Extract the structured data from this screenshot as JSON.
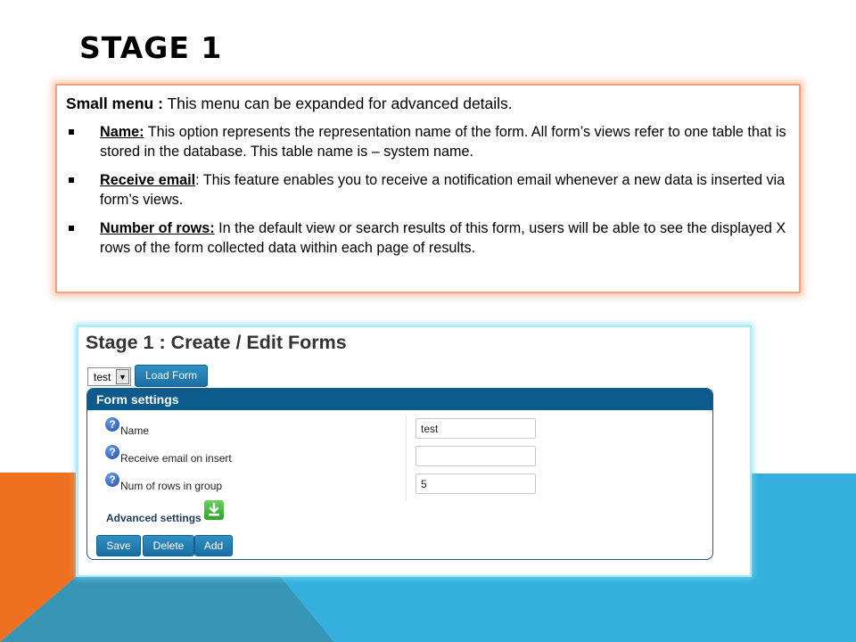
{
  "slide": {
    "title": "STAGE 1"
  },
  "info": {
    "intro_term": "Small menu :",
    "intro_text": " This menu can be expanded for advanced details.",
    "bullets": [
      {
        "term": "Name:",
        "text": " This option represents the representation name of the form. All form’s views refer to one table that is stored in the database. This table name is – system name."
      },
      {
        "term": "Receive email",
        "text": ": This feature enables you to receive a notification email whenever a new data is inserted via form’s views."
      },
      {
        "term": "Number of rows:",
        "text": " In the default view or search results of this form, users will be able to see the displayed X rows of the form collected data within each page of results."
      }
    ]
  },
  "form": {
    "heading": "Stage 1 : Create / Edit Forms",
    "select_value": "test",
    "load_button": "Load Form",
    "panel_title": "Form settings",
    "fields": [
      {
        "label": "Name",
        "value": "test"
      },
      {
        "label": "Receive email on insert",
        "value": ""
      },
      {
        "label": "Num of rows in group",
        "value": "5"
      }
    ],
    "advanced_label": "Advanced settings",
    "buttons": {
      "save": "Save",
      "delete": "Delete",
      "add": "Add"
    }
  },
  "colors": {
    "accent_orange": "#f07021",
    "accent_blue": "#35b0de",
    "accent_teal": "#3795b5",
    "panel_header": "#0d5b8c"
  }
}
